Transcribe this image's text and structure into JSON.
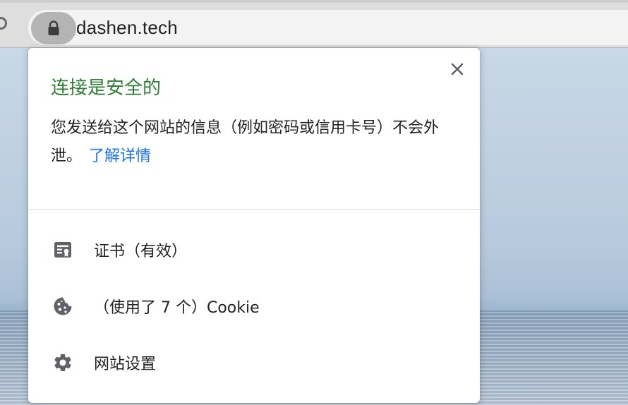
{
  "browser": {
    "url": "dashen.tech"
  },
  "popup": {
    "title": "连接是安全的",
    "description": "您发送给这个网站的信息（例如密码或信用卡号）不会外泄。",
    "learn_more": "了解详情",
    "rows": [
      {
        "label": "证书（有效）",
        "icon": "certificate-icon"
      },
      {
        "label": "（使用了 7 个）Cookie",
        "icon": "cookie-icon"
      },
      {
        "label": "网站设置",
        "icon": "gear-icon"
      }
    ]
  },
  "colors": {
    "secure_green": "#2e7d32",
    "link_blue": "#1a73e8",
    "icon_gray": "#5f6368"
  }
}
